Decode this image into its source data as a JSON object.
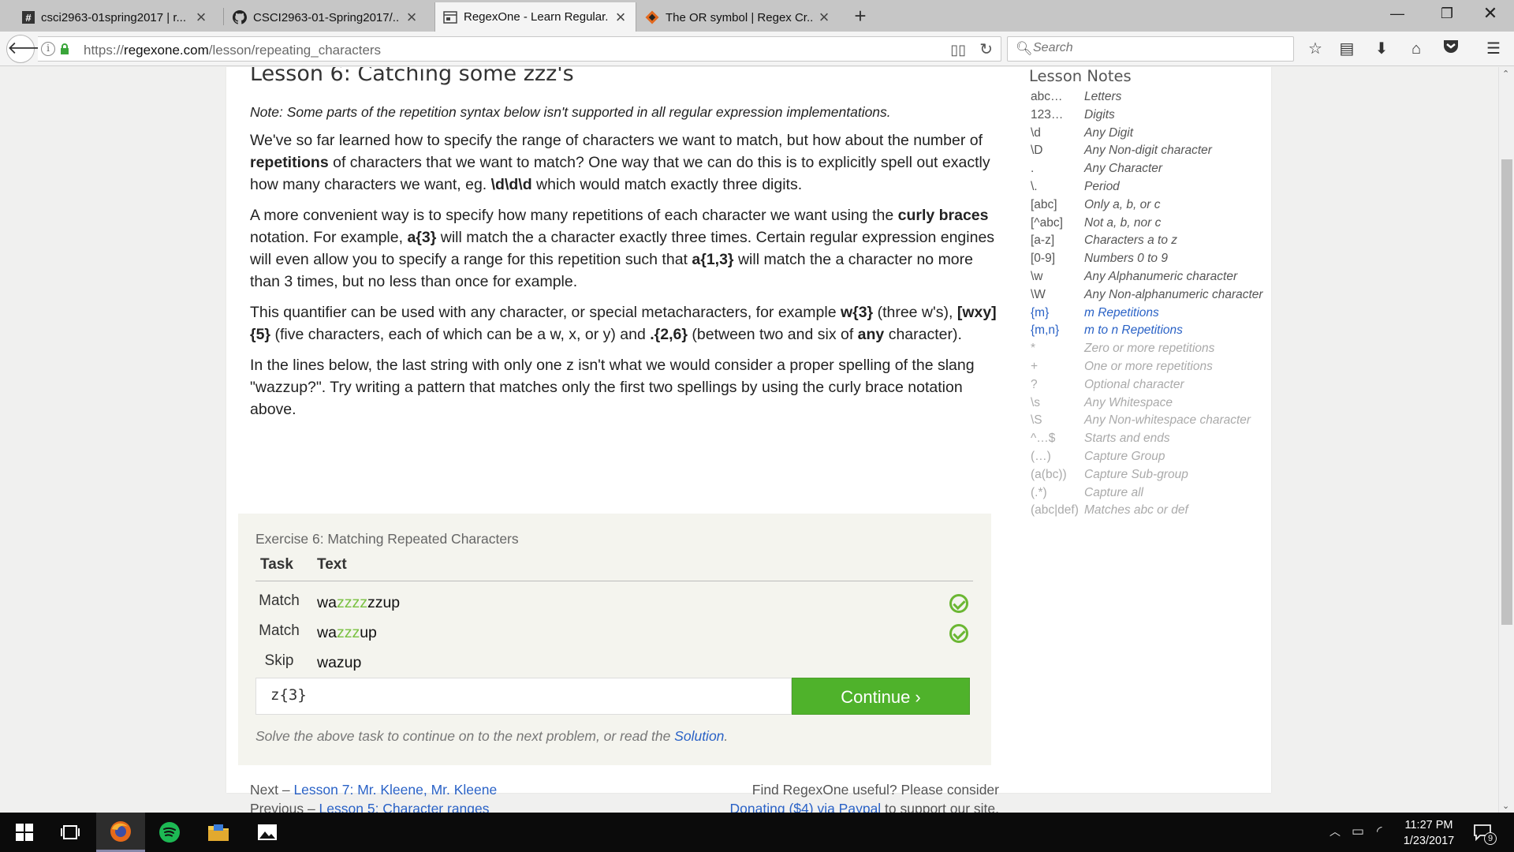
{
  "tabs": [
    {
      "title": "csci2963-01spring2017 | r...",
      "favicon": "#"
    },
    {
      "title": "CSCI2963-01-Spring2017/...",
      "favicon": "github"
    },
    {
      "title": "RegexOne - Learn Regular...",
      "favicon": "page"
    },
    {
      "title": "The OR symbol | Regex Cr...",
      "favicon": "regexcrossword"
    }
  ],
  "url": {
    "prefix": "https://",
    "domain": "regexone.com",
    "path": "/lesson/repeating_characters"
  },
  "search": {
    "placeholder": "Search"
  },
  "lesson": {
    "title": "Lesson 6: Catching some zzz's",
    "note": "Note: Some parts of the repetition syntax below isn't supported in all regular expression implementations.",
    "p1": [
      "We've so far learned how to specify the range of characters we want to match, but how about the number of ",
      "repetitions",
      " of characters that we want to match? One way that we can do this is to explicitly spell out exactly how many characters we want, eg. ",
      "\\d\\d\\d",
      " which would match exactly three digits."
    ],
    "p2": [
      "A more convenient way is to specify how many repetitions of each character we want using the ",
      "curly braces",
      " notation. For example, ",
      "a{3}",
      " will match the a character exactly three times. Certain regular expression engines will even allow you to specify a range for this repetition such that ",
      "a{1,3}",
      " will match the a character no more than 3 times, but no less than once for example."
    ],
    "p3": [
      "This quantifier can be used with any character, or special metacharacters, for example ",
      "w{3}",
      " (three w's), ",
      "[wxy]{5}",
      " (five characters, each of which can be a w, x, or y) and ",
      ".{2,6}",
      " (between two and six of ",
      "any",
      " character)."
    ],
    "p4": "In the lines below, the last string with only one z isn't what we would consider a proper spelling of the slang \"wazzup?\". Try writing a pattern that matches only the first two spellings by using the curly brace notation above."
  },
  "exercise": {
    "title": "Exercise 6: Matching Repeated Characters",
    "col_task": "Task",
    "col_text": "Text",
    "rows": [
      {
        "task": "Match",
        "pre": "wa",
        "hl": "zzzz",
        "post": "zzup"
      },
      {
        "task": "Match",
        "pre": "wa",
        "hl": "zzz",
        "post": "up"
      },
      {
        "task": "Skip",
        "pre": "wazup",
        "hl": "",
        "post": ""
      }
    ],
    "answer": "z{3}",
    "continue_label": "Continue ›",
    "solve_text": "Solve the above task to continue on to the next problem, or read the ",
    "solution_link": "Solution",
    "solve_end": "."
  },
  "pager": {
    "next_prefix": "Next – ",
    "next_link": "Lesson 7: Mr. Kleene, Mr. Kleene",
    "prev_prefix": "Previous – ",
    "prev_link": "Lesson 5: Character ranges",
    "donate_text": "Find RegexOne useful? Please consider",
    "donate_link": "Donating ($4) via Paypal",
    "donate_end": " to support our site."
  },
  "notes": {
    "title": "Lesson Notes",
    "items": [
      {
        "k": "abc…",
        "v": "Letters",
        "state": "done"
      },
      {
        "k": "123…",
        "v": "Digits",
        "state": "done"
      },
      {
        "k": "\\d",
        "v": "Any Digit",
        "state": "done"
      },
      {
        "k": "\\D",
        "v": "Any Non-digit character",
        "state": "done"
      },
      {
        "k": ".",
        "v": "Any Character",
        "state": "done"
      },
      {
        "k": "\\.",
        "v": "Period",
        "state": "done"
      },
      {
        "k": "[abc]",
        "v": "Only a, b, or c",
        "state": "done"
      },
      {
        "k": "[^abc]",
        "v": "Not a, b, nor c",
        "state": "done"
      },
      {
        "k": "[a-z]",
        "v": "Characters a to z",
        "state": "done"
      },
      {
        "k": "[0-9]",
        "v": "Numbers 0 to 9",
        "state": "done"
      },
      {
        "k": "\\w",
        "v": "Any Alphanumeric character",
        "state": "done"
      },
      {
        "k": "\\W",
        "v": "Any Non-alphanumeric character",
        "state": "done"
      },
      {
        "k": "{m}",
        "v": "m Repetitions",
        "state": "cur"
      },
      {
        "k": "{m,n}",
        "v": "m to n Repetitions",
        "state": "cur"
      },
      {
        "k": "*",
        "v": "Zero or more repetitions",
        "state": "fut"
      },
      {
        "k": "+",
        "v": "One or more repetitions",
        "state": "fut"
      },
      {
        "k": "?",
        "v": "Optional character",
        "state": "fut"
      },
      {
        "k": "\\s",
        "v": "Any Whitespace",
        "state": "fut"
      },
      {
        "k": "\\S",
        "v": "Any Non-whitespace character",
        "state": "fut"
      },
      {
        "k": "^…$",
        "v": "Starts and ends",
        "state": "fut"
      },
      {
        "k": "(…)",
        "v": "Capture Group",
        "state": "fut"
      },
      {
        "k": "(a(bc))",
        "v": "Capture Sub-group",
        "state": "fut"
      },
      {
        "k": "(.*)",
        "v": "Capture all",
        "state": "fut"
      },
      {
        "k": "(abc|def)",
        "v": "Matches abc or def",
        "state": "fut"
      }
    ]
  },
  "taskbar": {
    "time": "11:27 PM",
    "date": "1/23/2017",
    "notifications": "9"
  },
  "colors": {
    "accent_green": "#4fb22b",
    "link_blue": "#2a62c6",
    "check_green": "#6bb733"
  }
}
